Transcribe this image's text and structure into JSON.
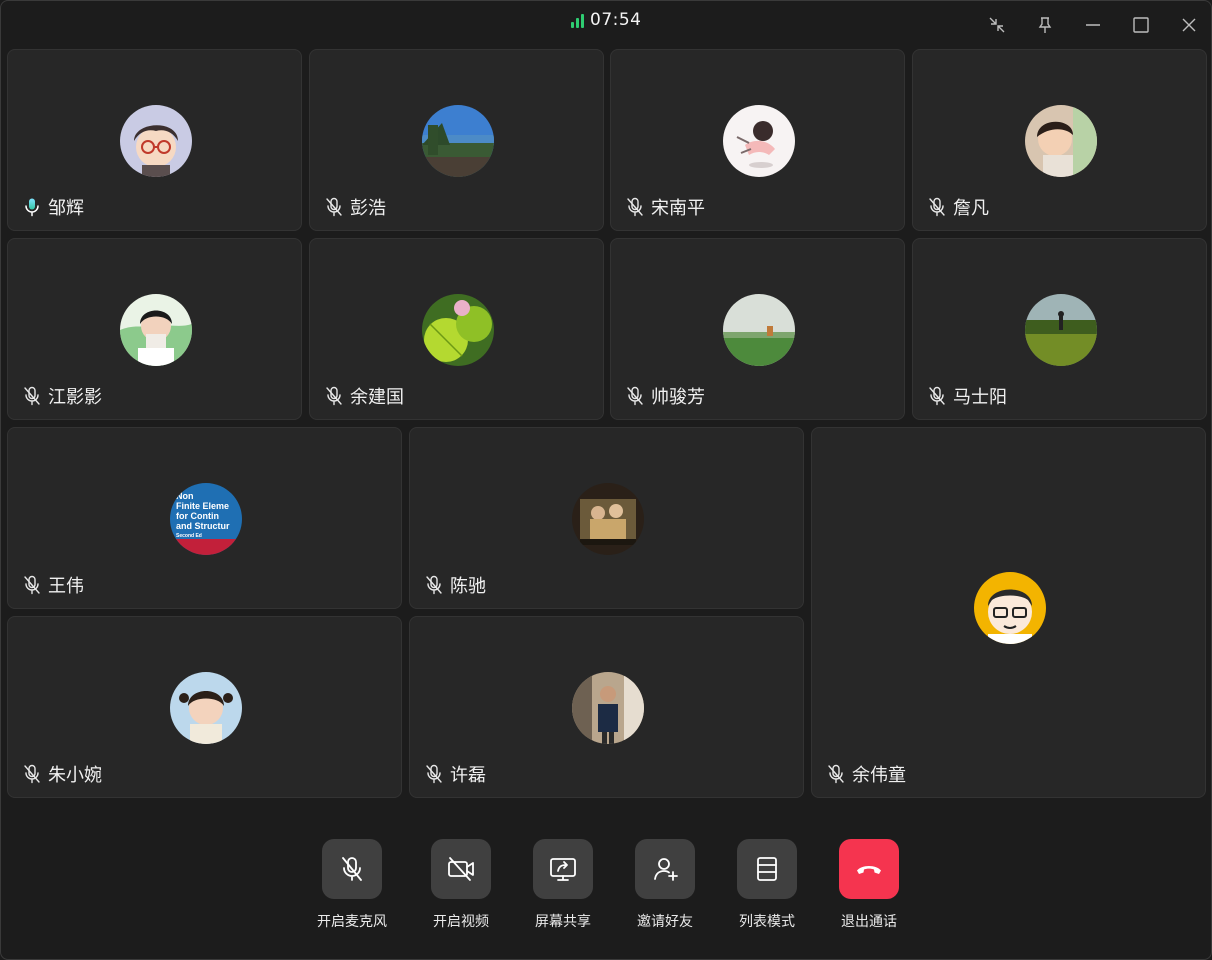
{
  "titlebar": {
    "time": "07:54",
    "signal_color": "#2ecc71",
    "buttons": [
      "shrink-icon",
      "pin-icon",
      "minimize-icon",
      "maximize-icon",
      "close-icon"
    ]
  },
  "participants": [
    {
      "name": "邹辉",
      "mic": "active",
      "avatar": "cartoon-boy-glasses"
    },
    {
      "name": "彭浩",
      "mic": "muted",
      "avatar": "landscape-sea"
    },
    {
      "name": "宋南平",
      "mic": "muted",
      "avatar": "cartoon-girl-running"
    },
    {
      "name": "詹凡",
      "mic": "muted",
      "avatar": "child-photo"
    },
    {
      "name": "江影影",
      "mic": "muted",
      "avatar": "child-drinking"
    },
    {
      "name": "余建国",
      "mic": "muted",
      "avatar": "lotus-leaf"
    },
    {
      "name": "帅骏芳",
      "mic": "muted",
      "avatar": "green-field"
    },
    {
      "name": "马士阳",
      "mic": "muted",
      "avatar": "flower-field"
    },
    {
      "name": "王伟",
      "mic": "muted",
      "avatar": "book-cover",
      "avatar_text": [
        "Non",
        "Finite Eleme",
        "for Contin",
        "and Structur",
        "Second Ed"
      ]
    },
    {
      "name": "陈驰",
      "mic": "muted",
      "avatar": "group-photo"
    },
    {
      "name": "余伟童",
      "mic": "muted",
      "avatar": "cartoon-man-glasses"
    },
    {
      "name": "朱小婉",
      "mic": "muted",
      "avatar": "child-pigtails"
    },
    {
      "name": "许磊",
      "mic": "muted",
      "avatar": "man-standing"
    }
  ],
  "toolbar": {
    "mic_label": "开启麦克风",
    "video_label": "开启视频",
    "share_label": "屏幕共享",
    "invite_label": "邀请好友",
    "list_label": "列表模式",
    "hangup_label": "退出通话",
    "hangup_color": "#f5344f"
  }
}
